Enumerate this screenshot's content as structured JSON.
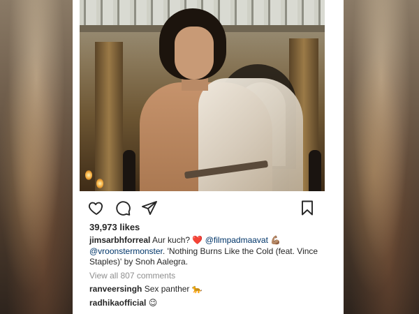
{
  "post": {
    "likes_text": "39,973 likes",
    "caption": {
      "username": "jimsarbhforreal",
      "text_1": "Aur kuch?",
      "heart_emoji": "❤️",
      "mention_1": "@filmpadmaavat",
      "muscle_emoji": "💪🏽",
      "mention_2": "@vroonstermonster",
      "text_2": ". 'Nothing Burns Like the Cold (feat. Vince Staples)' by Snoh Aalegra."
    },
    "view_all_comments": "View all 807 comments",
    "comments": [
      {
        "username": "ranveersingh",
        "text": "Sex panther",
        "emoji": "🐆"
      },
      {
        "username": "radhikaofficial",
        "text": "",
        "emoji": "😉"
      }
    ]
  },
  "icons": {
    "like": "heart-icon",
    "comment": "comment-bubble-icon",
    "share": "paper-plane-icon",
    "save": "bookmark-icon"
  },
  "colors": {
    "text": "#262626",
    "mention": "#003569",
    "muted": "#8e8e8e",
    "heart": "#ed4956"
  }
}
